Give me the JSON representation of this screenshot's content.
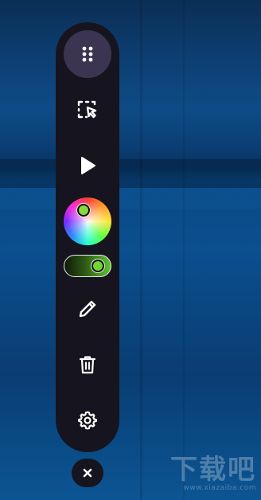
{
  "toolbar": {
    "tools": [
      {
        "name": "drag-handle",
        "icon": "grip-icon",
        "active": true
      },
      {
        "name": "select",
        "icon": "select-cursor-icon"
      },
      {
        "name": "play",
        "icon": "play-icon"
      },
      {
        "name": "color",
        "icon": "color-wheel-icon"
      },
      {
        "name": "toggle",
        "icon": "toggle-switch",
        "state": "on"
      },
      {
        "name": "pen",
        "icon": "pencil-icon"
      },
      {
        "name": "delete",
        "icon": "trash-icon"
      },
      {
        "name": "settings",
        "icon": "gear-icon"
      }
    ],
    "colors": {
      "bar_bg": "#16151f",
      "active_bg": "#3b3552",
      "icon": "#ffffff",
      "toggle_accent": "#5dc72e"
    }
  },
  "close": {
    "icon": "close-icon"
  },
  "watermark": {
    "text": "下载吧",
    "url": "www.xiazaiba.com"
  }
}
